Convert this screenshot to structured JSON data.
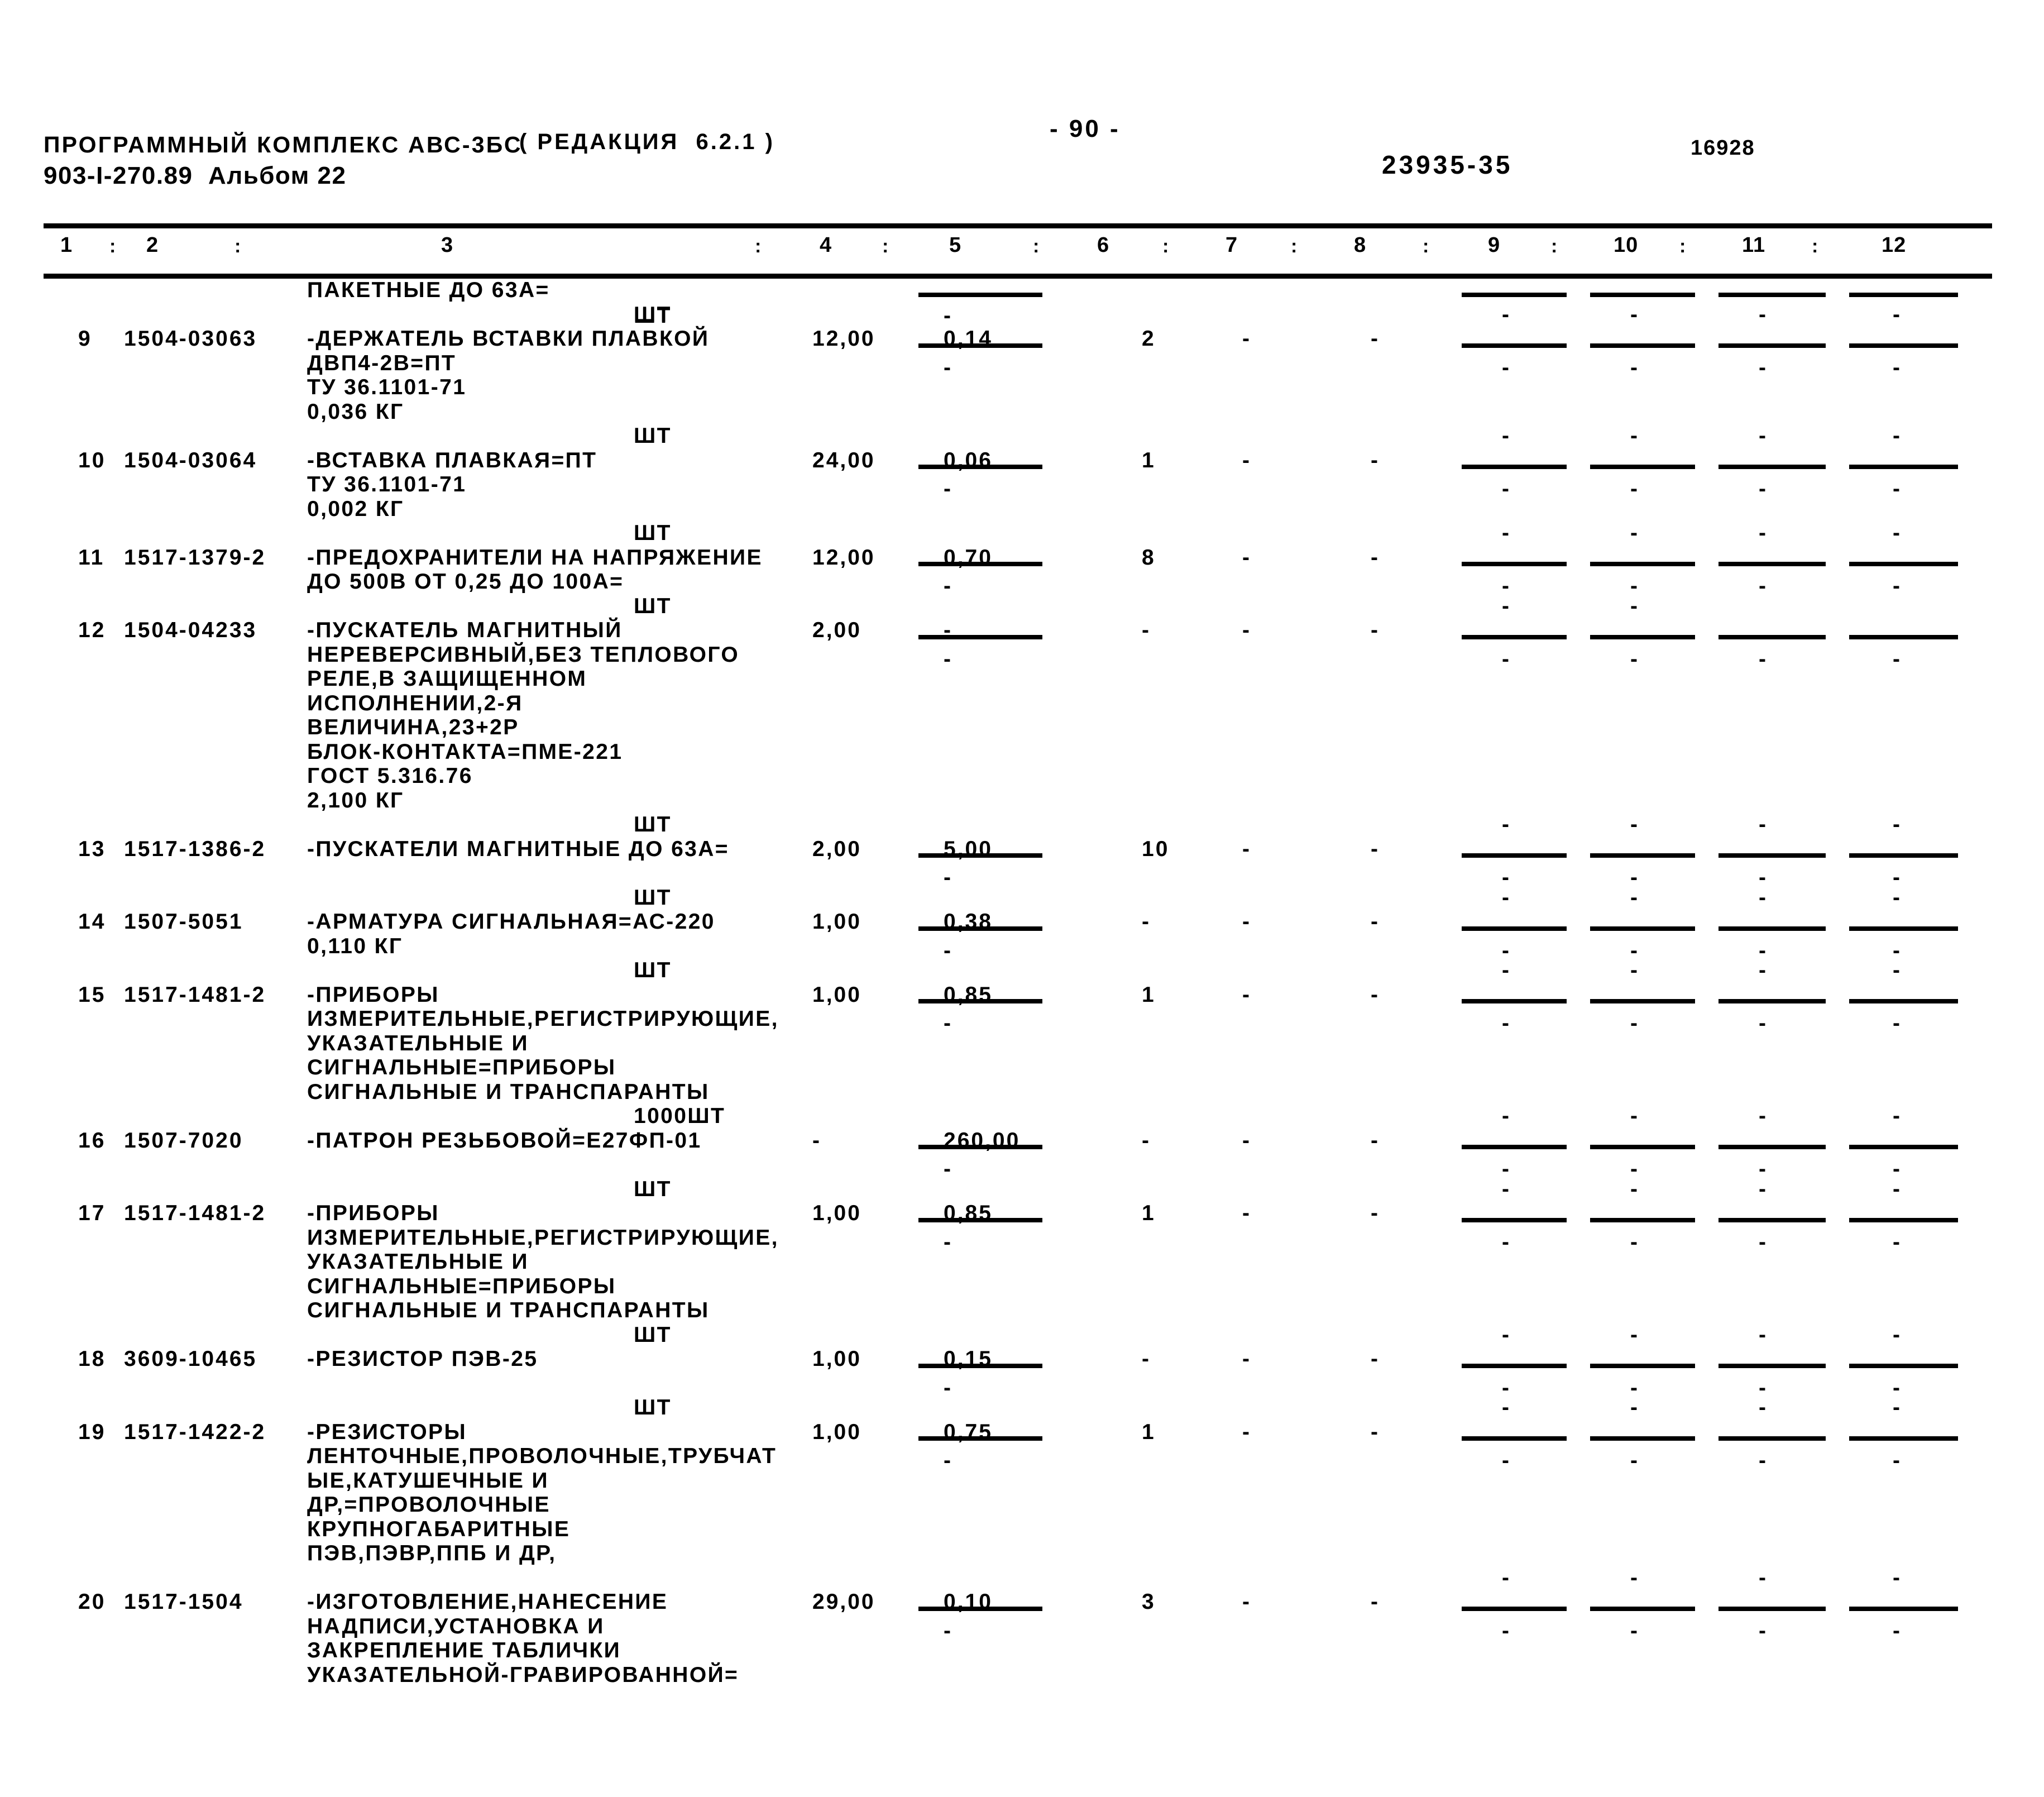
{
  "header": {
    "program_title": "ПРОГРАММНЫЙ КОМПЛЕКС АВС-3БС",
    "document_code": "903-I-270.89  Альбом 22",
    "edition": "( РЕДАКЦИЯ  6.2.1 )",
    "page_number": "- 90 -",
    "sheet_code": "23935-35",
    "doc_id": "16928"
  },
  "columns": {
    "numbers": [
      "1",
      "2",
      "3",
      "4",
      "5",
      "6",
      "7",
      "8",
      "9",
      "10",
      "11",
      "12"
    ],
    "separator": ":"
  },
  "rows": [
    {
      "pos": "",
      "code": "",
      "desc_lines": [
        "ПАКЕТНЫЕ ДО 63А="
      ],
      "unit": "ШТ",
      "c4": "",
      "c5": "",
      "c6": "",
      "c7": "",
      "c8": "",
      "c9": "",
      "c10": "",
      "c11": "",
      "c12": ""
    },
    {
      "pos": "9",
      "code": "1504-03063",
      "desc_lines": [
        "-ДЕРЖАТЕЛЬ ВСТАВКИ ПЛАВКОЙ",
        "ДВП4-2В=ПТ",
        "ТУ 36.1101-71",
        "0,036 КГ"
      ],
      "unit": "ШТ",
      "c4": "12,00",
      "c5": "0,14",
      "c6": "2",
      "c7": "-",
      "c8": "-",
      "c9": "-",
      "c10": "-",
      "c11": "-",
      "c12": "-"
    },
    {
      "pos": "10",
      "code": "1504-03064",
      "desc_lines": [
        "-ВСТАВКА ПЛАВКАЯ=ПТ",
        "ТУ 36.1101-71",
        "0,002 КГ"
      ],
      "unit": "ШТ",
      "c4": "24,00",
      "c5": "0,06",
      "c6": "1",
      "c7": "-",
      "c8": "-",
      "c9": "-",
      "c10": "-",
      "c11": "-",
      "c12": "-"
    },
    {
      "pos": "11",
      "code": "1517-1379-2",
      "desc_lines": [
        "-ПРЕДОХРАНИТЕЛИ НА НАПРЯЖЕНИЕ",
        "ДО 500В ОТ 0,25 ДО 100А="
      ],
      "unit": "ШТ",
      "c4": "12,00",
      "c5": "0,70",
      "c6": "8",
      "c7": "-",
      "c8": "-",
      "c9": "-",
      "c10": "-",
      "c11": "-",
      "c12": "-"
    },
    {
      "pos": "12",
      "code": "1504-04233",
      "desc_lines": [
        "-ПУСКАТЕЛЬ МАГНИТНЫЙ",
        "НЕРЕВЕРСИВНЫЙ,БЕЗ ТЕПЛОВОГО",
        "РЕЛЕ,В ЗАЩИЩЕННОМ",
        "ИСПОЛНЕНИИ,2-Я",
        "ВЕЛИЧИНА,23+2Р",
        "БЛОК-КОНТАКТА=ПМЕ-221",
        "ГОСТ 5.316.76",
        "2,100 КГ"
      ],
      "unit": "ШТ",
      "c4": "2,00",
      "c5": "-",
      "c6": "-",
      "c7": "-",
      "c8": "-",
      "c9": "-",
      "c10": "-",
      "c11": "",
      "c12": ""
    },
    {
      "pos": "13",
      "code": "1517-1386-2",
      "desc_lines": [
        "-ПУСКАТЕЛИ МАГНИТНЫЕ ДО 63А="
      ],
      "unit": "ШТ",
      "c4": "2,00",
      "c5": "5,00",
      "c6": "10",
      "c7": "-",
      "c8": "-",
      "c9": "-",
      "c10": "-",
      "c11": "-",
      "c12": "-"
    },
    {
      "pos": "14",
      "code": "1507-5051",
      "desc_lines": [
        "-АРМАТУРА СИГНАЛЬНАЯ=АС-220",
        "0,110 КГ"
      ],
      "unit": "ШТ",
      "c4": "1,00",
      "c5": "0,38",
      "c6": "-",
      "c7": "-",
      "c8": "-",
      "c9": "-",
      "c10": "-",
      "c11": "-",
      "c12": "-"
    },
    {
      "pos": "15",
      "code": "1517-1481-2",
      "desc_lines": [
        "-ПРИБОРЫ",
        "ИЗМЕРИТЕЛЬНЫЕ,РЕГИСТРИРУЮЩИЕ,",
        "УКАЗАТЕЛЬНЫЕ И",
        "СИГНАЛЬНЫЕ=ПРИБОРЫ",
        "СИГНАЛЬНЫЕ И ТРАНСПАРАНТЫ"
      ],
      "unit": "ШТ",
      "c4": "1,00",
      "c5": "0,85",
      "c6": "1",
      "c7": "-",
      "c8": "-",
      "c9": "-",
      "c10": "-",
      "c11": "-",
      "c12": "-"
    },
    {
      "pos": "16",
      "code": "1507-7020",
      "desc_lines": [
        "-ПАТРОН РЕЗЬБОВОЙ=Е27ФП-01"
      ],
      "unit": "1000ШТ",
      "c4": "-",
      "c5": "260,00",
      "c6": "-",
      "c7": "-",
      "c8": "-",
      "c9": "-",
      "c10": "-",
      "c11": "-",
      "c12": "-"
    },
    {
      "pos": "17",
      "code": "1517-1481-2",
      "desc_lines": [
        "-ПРИБОРЫ",
        "ИЗМЕРИТЕЛЬНЫЕ,РЕГИСТРИРУЮЩИЕ,",
        "УКАЗАТЕЛЬНЫЕ И",
        "СИГНАЛЬНЫЕ=ПРИБОРЫ",
        "СИГНАЛЬНЫЕ И ТРАНСПАРАНТЫ"
      ],
      "unit": "ШТ",
      "c4": "1,00",
      "c5": "0,85",
      "c6": "1",
      "c7": "-",
      "c8": "-",
      "c9": "-",
      "c10": "-",
      "c11": "-",
      "c12": "-"
    },
    {
      "pos": "18",
      "code": "3609-10465",
      "desc_lines": [
        "-РЕЗИСТОР ПЭВ-25"
      ],
      "unit": "ШТ",
      "c4": "1,00",
      "c5": "0,15",
      "c6": "-",
      "c7": "-",
      "c8": "-",
      "c9": "-",
      "c10": "-",
      "c11": "-",
      "c12": "-"
    },
    {
      "pos": "19",
      "code": "1517-1422-2",
      "desc_lines": [
        "-РЕЗИСТОРЫ",
        "ЛЕНТОЧНЫЕ,ПРОВОЛОЧНЫЕ,ТРУБЧАТ",
        "ЫЕ,КАТУШЕЧНЫЕ И",
        "ДР,=ПРОВОЛОЧНЫЕ",
        "КРУПНОГАБАРИТНЫЕ",
        "ПЭВ,ПЭВР,ППБ И ДР,"
      ],
      "unit": "ШТ",
      "c4": "1,00",
      "c5": "0,75",
      "c6": "1",
      "c7": "-",
      "c8": "-",
      "c9": "-",
      "c10": "-",
      "c11": "-",
      "c12": "-"
    },
    {
      "pos": "20",
      "code": "1517-1504",
      "desc_lines": [
        "-ИЗГОТОВЛЕНИЕ,НАНЕСЕНИЕ",
        "НАДПИСИ,УСТАНОВКА И",
        "ЗАКРЕПЛЕНИЕ ТАБЛИЧКИ",
        "УКАЗАТЕЛЬНОЙ-ГРАВИРОВАННОЙ="
      ],
      "unit": "",
      "c4": "29,00",
      "c5": "0,10",
      "c6": "3",
      "c7": "-",
      "c8": "-",
      "c9": "-",
      "c10": "-",
      "c11": "-",
      "c12": "-"
    }
  ]
}
